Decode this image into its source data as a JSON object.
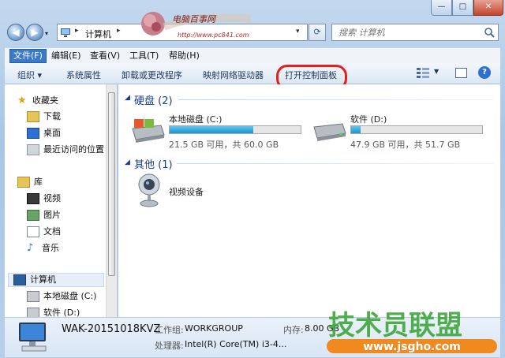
{
  "window": {
    "minimize_glyph": "—",
    "maximize_glyph": "□",
    "close_glyph": "✕"
  },
  "address": {
    "crumb": "计算机",
    "sep": "▸",
    "dropdown": "▾"
  },
  "search": {
    "placeholder": "搜索 计算机"
  },
  "watermark_top": {
    "title": "电脑百事网",
    "url": "http://www.pc841.com"
  },
  "menu": {
    "items": [
      "文件(F)",
      "编辑(E)",
      "查看(V)",
      "工具(T)",
      "帮助(H)"
    ]
  },
  "toolbar": {
    "organize": "组织 ▾",
    "system_properties": "系统属性",
    "uninstall": "卸载或更改程序",
    "map_drive": "映射网络驱动器",
    "open_control_panel": "打开控制面板",
    "help": "?"
  },
  "nav": {
    "favorites": "收藏夹",
    "downloads": "下载",
    "desktop": "桌面",
    "recent": "最近访问的位置",
    "libraries": "库",
    "videos": "视频",
    "pictures": "图片",
    "documents": "文档",
    "music": "音乐",
    "computer": "计算机",
    "local_c": "本地磁盘 (C:)",
    "software_d": "软件 (D:)"
  },
  "content": {
    "hdd_header": "硬盘 (2)",
    "other_header": "其他 (1)",
    "drives": [
      {
        "name": "本地磁盘 (C:)",
        "usage": "21.5 GB 可用，共 60.0 GB",
        "used_fraction": 0.64
      },
      {
        "name": "软件 (D:)",
        "usage": "47.9 GB 可用，共 51.7 GB",
        "used_fraction": 0.07
      }
    ],
    "other_device": "视频设备"
  },
  "details": {
    "computer_name": "WAK-20151018KVZ",
    "workgroup_label": "工作组:",
    "workgroup_value": "WORKGROUP",
    "memory_label": "内存:",
    "memory_value": "8.00 GB",
    "cpu_label": "处理器:",
    "cpu_value": "Intel(R) Core(TM) i3-4..."
  },
  "watermark_site": {
    "brand": "技术员联盟",
    "url": "www.jsgho.com"
  },
  "colors": {
    "accent": "#1a3d8f",
    "highlight_ring": "#e2201f",
    "drive_fill": "#1a93cc"
  }
}
